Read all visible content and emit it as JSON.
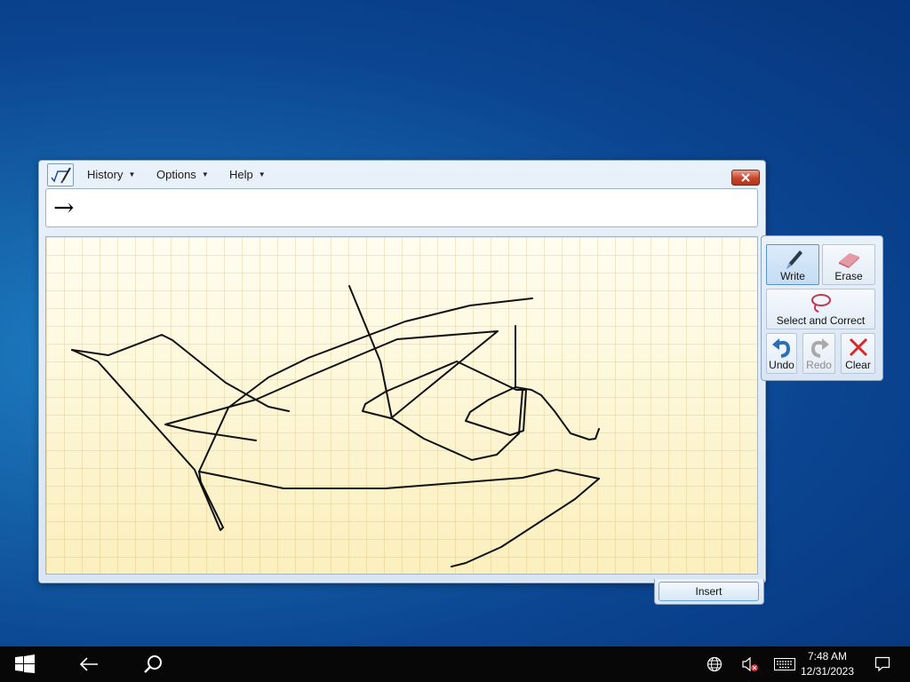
{
  "window": {
    "menu": {
      "history": "History",
      "options": "Options",
      "help": "Help"
    },
    "preview_text": "→",
    "insert_label": "Insert"
  },
  "tools": {
    "write": "Write",
    "erase": "Erase",
    "select_correct": "Select and Correct",
    "undo": "Undo",
    "redo": "Redo",
    "clear": "Clear"
  },
  "taskbar": {
    "time": "7:48 AM",
    "date": "12/31/2023"
  },
  "colors": {
    "close_red": "#c7452c",
    "ink": "#111111",
    "accent_blue": "#2a6fb8"
  },
  "icons": [
    "app-icon",
    "close-icon",
    "pen-icon",
    "eraser-icon",
    "lasso-icon",
    "undo-icon",
    "redo-icon",
    "clear-icon",
    "windows-start-icon",
    "back-arrow-icon",
    "search-icon",
    "globe-icon",
    "volume-muted-icon",
    "keyboard-icon",
    "notification-icon"
  ]
}
